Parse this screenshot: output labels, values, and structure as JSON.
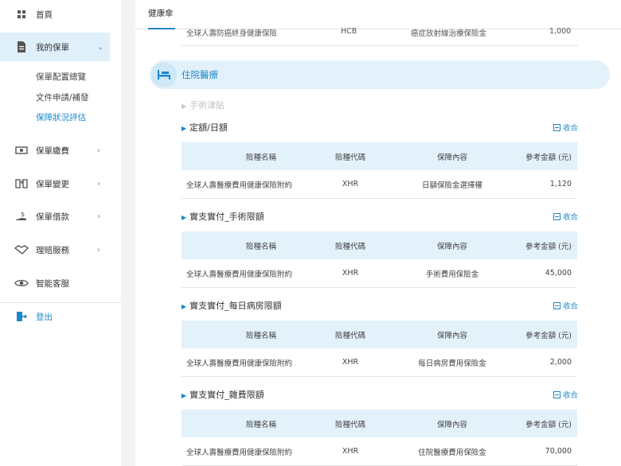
{
  "sidebar": {
    "items": [
      {
        "label": "首頁",
        "icon": "grid-icon"
      },
      {
        "label": "我的保單",
        "icon": "document-icon"
      },
      {
        "label": "保單繳費",
        "icon": "cash-icon"
      },
      {
        "label": "保單變更",
        "icon": "transfer-icon"
      },
      {
        "label": "保單借款",
        "icon": "loan-icon"
      },
      {
        "label": "理賠服務",
        "icon": "handshake-icon"
      },
      {
        "label": "智能客服",
        "icon": "eye-icon"
      }
    ],
    "subitems": [
      {
        "label": "保單配置總覽"
      },
      {
        "label": "文件申請/補發"
      },
      {
        "label": "保障狀況評估"
      }
    ],
    "logout": {
      "label": "登出",
      "icon": "logout-icon"
    }
  },
  "tabs": [
    {
      "label": "健康傘"
    }
  ],
  "top_row": {
    "name": "全球人壽防癌終身健康保險",
    "code": "HCB",
    "content": "癌症放射線治療保險金",
    "amount": "1,000"
  },
  "section": {
    "title": "住院醫療",
    "icon": "hospital-bed-icon"
  },
  "muted_heading": "手術津貼",
  "collapse_label": "收合",
  "table_headers": {
    "name": "險種名稱",
    "code": "險種代碼",
    "content": "保障內容",
    "amount": "參考金額 (元)"
  },
  "groups": [
    {
      "title": "定額/日額",
      "row": {
        "name": "全球人壽醫療費用健康保險附約",
        "code": "XHR",
        "content": "日額保險金選擇權",
        "amount": "1,120"
      }
    },
    {
      "title": "實支實付_手術限額",
      "row": {
        "name": "全球人壽醫療費用健康保險附約",
        "code": "XHR",
        "content": "手術費用保險金",
        "amount": "45,000"
      }
    },
    {
      "title": "實支實付_每日病房限額",
      "row": {
        "name": "全球人壽醫療費用健康保險附約",
        "code": "XHR",
        "content": "每日病房費用保險金",
        "amount": "2,000"
      }
    },
    {
      "title": "實支實付_雜費限額",
      "row": {
        "name": "全球人壽醫療費用健康保險附約",
        "code": "XHR",
        "content": "住院醫療費用保險金",
        "amount": "70,000"
      }
    }
  ],
  "colors": {
    "accent": "#1b87c9",
    "highlight": "#dff0fb",
    "table_header_bg": "#e3f1fb"
  }
}
